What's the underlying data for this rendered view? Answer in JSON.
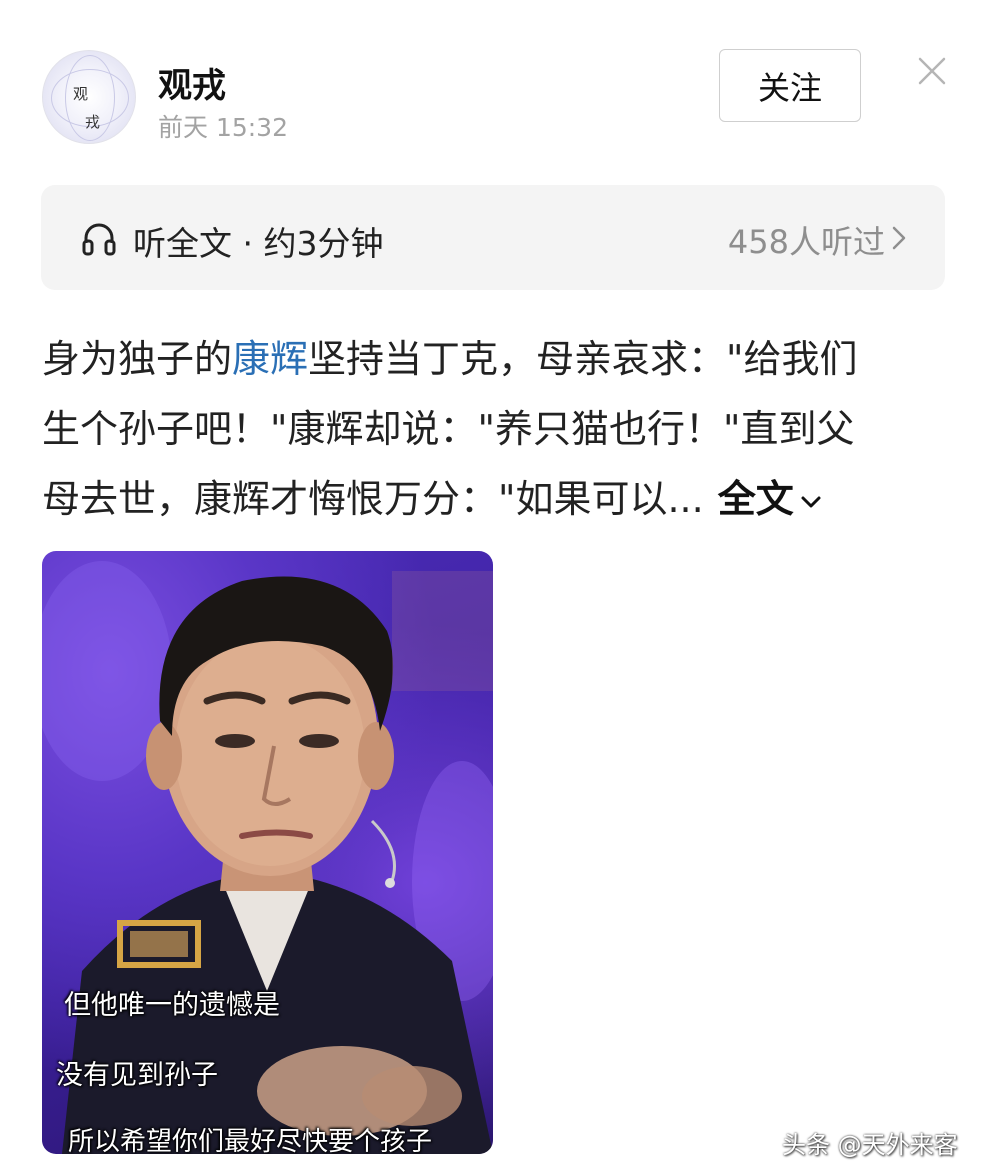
{
  "author": {
    "name": "观戎",
    "time": "前天  15:32",
    "avatar_chars": [
      "观",
      "戎"
    ]
  },
  "header": {
    "follow_label": "关注",
    "close_icon": "close-icon"
  },
  "listen": {
    "label": "听全文 · 约3分钟",
    "count": "458人听过",
    "icon": "headphone-icon"
  },
  "article": {
    "line1_pre": "身为独子的",
    "line1_link": "康辉",
    "line1_post": "坚持当丁克，母亲哀求：\"给我们",
    "line2": "生个孙子吧！\"康辉却说：\"养只猫也行！\"直到父",
    "line3": "母去世，康辉才悔恨万分：\"如果可以...",
    "full_text_label": "全文"
  },
  "image": {
    "subtitles": [
      "但他唯一的遗憾是",
      "没有见到孙子",
      "所以希望你们最好尽快要个孩子"
    ]
  },
  "watermark": "头条 @天外来客",
  "colors": {
    "link": "#2a6fb5",
    "muted": "#a3a3a3",
    "listen_bg": "#f4f4f4"
  }
}
